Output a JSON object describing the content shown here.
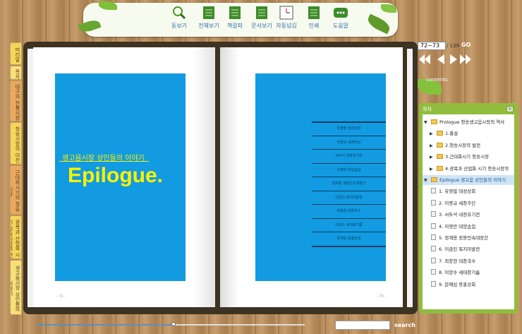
{
  "toolbar": {
    "buttons": [
      {
        "label": "돋보기",
        "icon": "magnifier-icon"
      },
      {
        "label": "전체보기",
        "icon": "books-icon"
      },
      {
        "label": "책갈피",
        "icon": "bookmark-icon"
      },
      {
        "label": "문서보기",
        "icon": "document-icon"
      },
      {
        "label": "자동넘김",
        "icon": "clock-icon"
      },
      {
        "label": "인쇄",
        "icon": "print-icon"
      },
      {
        "label": "도움말",
        "icon": "help-icon"
      }
    ]
  },
  "left_tabs": [
    "머리말",
    "목차",
    "대구의 전통시장",
    "청송시장의 이천",
    "근대화시기의 청송시장",
    "광복과 산업화 시기 청송시장의 현재",
    "생고음시장 상인들의 이야기"
  ],
  "book": {
    "left_page": {
      "subtitle": "생고음시장 상인들의 이야기",
      "title": "Epilogue.",
      "page_no": "- 72 -"
    },
    "right_page": {
      "page_no": "- 73 -",
      "entries": [
        "유영필 대성상회",
        "이명규 세창주단",
        "서두석 내장유기전",
        "이영만 대양솜집",
        "정계용 정용민속대장간",
        "이금진 복지미발전",
        "최창현 대창국수",
        "이양수 새대창기름",
        "문예심 용홍상회"
      ]
    }
  },
  "nav": {
    "page_input": "72~73",
    "total": "/ 139",
    "go": "GO",
    "contents_label": "contents"
  },
  "toc_panel": {
    "title": "목차",
    "close": "×",
    "items": [
      {
        "label": "Prologue 청송생고음시장의 역사",
        "level": 0,
        "type": "folder",
        "expanded": true
      },
      {
        "label": "1.총설",
        "level": 1,
        "type": "folder"
      },
      {
        "label": "2.청송시장의 발전",
        "level": 1,
        "type": "folder"
      },
      {
        "label": "3.근대화시기 청송시장",
        "level": 1,
        "type": "folder"
      },
      {
        "label": "4.광복과 산업화 시기 청송시장의",
        "level": 1,
        "type": "folder"
      },
      {
        "label": "Epilogue 생고음 상인들의 이야기",
        "level": 0,
        "type": "folder",
        "expanded": true,
        "selected": true
      },
      {
        "label": "1. 유영필 대성상회",
        "level": 1,
        "type": "doc"
      },
      {
        "label": "2. 이명규 세창주단",
        "level": 1,
        "type": "doc"
      },
      {
        "label": "3. 서두석 내장유기전",
        "level": 1,
        "type": "doc"
      },
      {
        "label": "4. 이영만 대양솜집",
        "level": 1,
        "type": "doc"
      },
      {
        "label": "5. 정계용 정용민속대장간",
        "level": 1,
        "type": "doc"
      },
      {
        "label": "6. 이금진 복지미발전",
        "level": 1,
        "type": "doc"
      },
      {
        "label": "7. 최창현 대창국수",
        "level": 1,
        "type": "doc"
      },
      {
        "label": "8. 이양수 새대창기름",
        "level": 1,
        "type": "doc"
      },
      {
        "label": "9. 문예심 용홍상회",
        "level": 1,
        "type": "doc"
      }
    ]
  },
  "bottom": {
    "search_label": "search",
    "search_value": "",
    "slider_value": 0.51
  }
}
